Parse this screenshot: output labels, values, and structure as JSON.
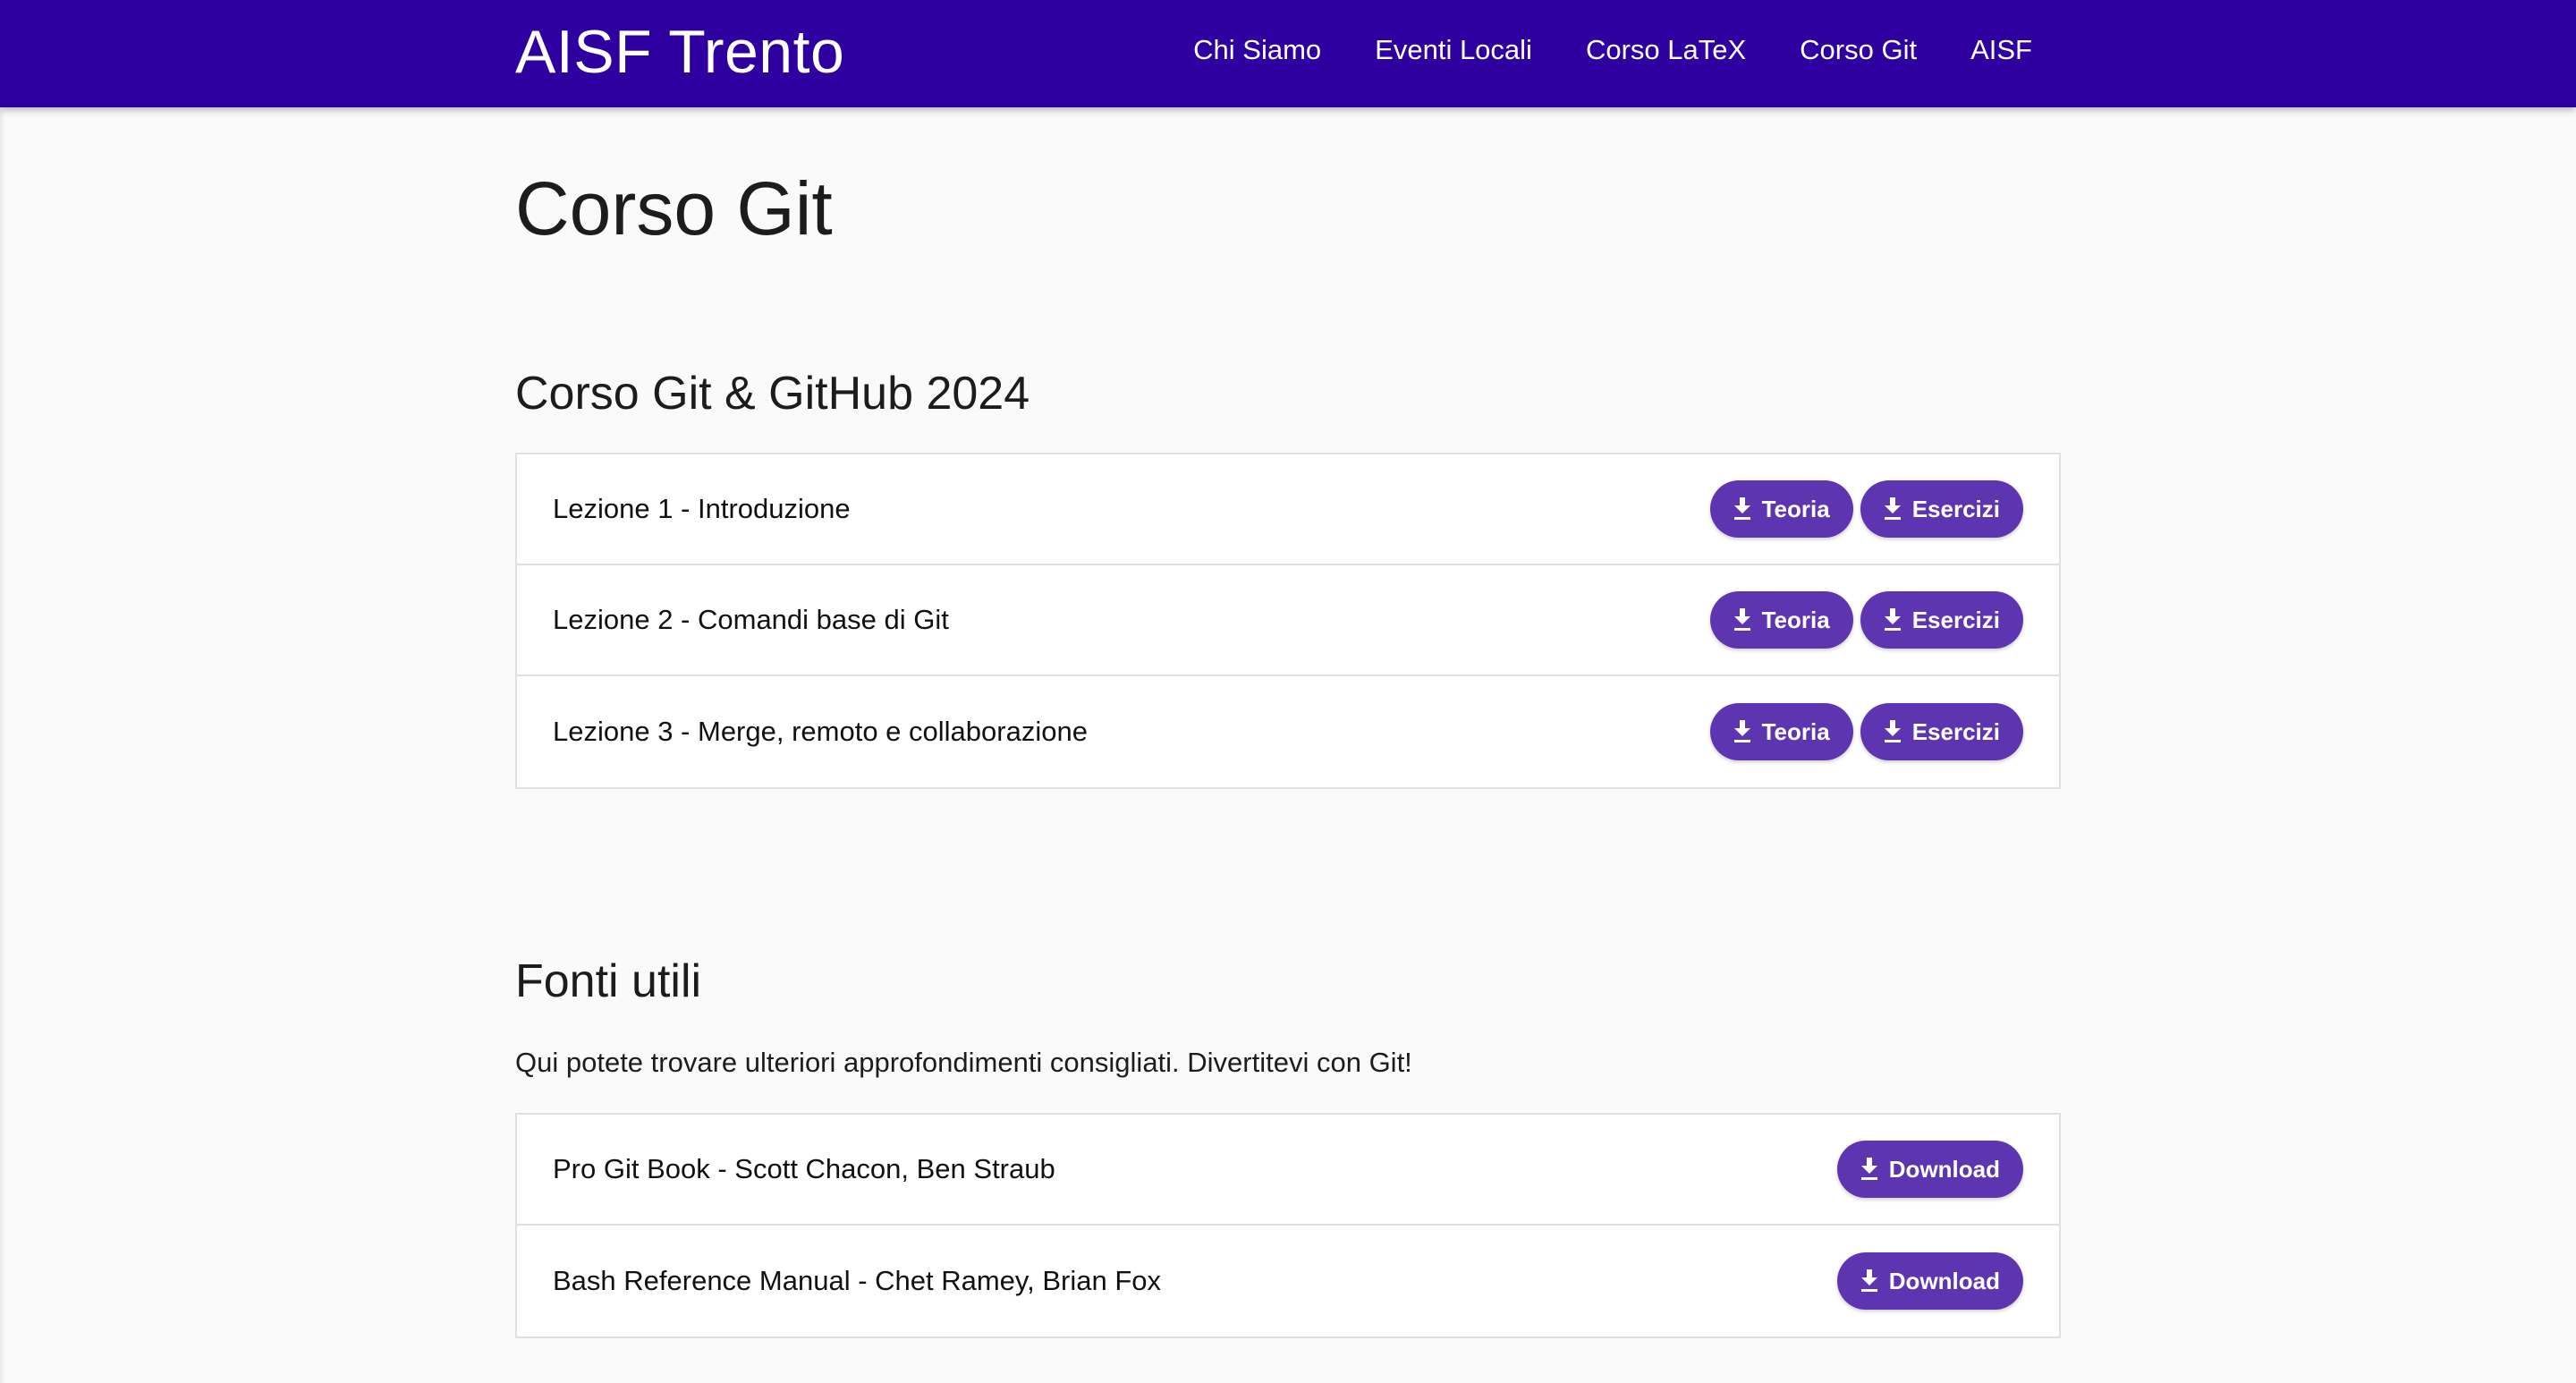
{
  "navbar": {
    "brand": "AISF Trento",
    "links": [
      "Chi Siamo",
      "Eventi Locali",
      "Corso LaTeX",
      "Corso Git",
      "AISF"
    ]
  },
  "page": {
    "title": "Corso Git"
  },
  "course": {
    "title": "Corso Git & GitHub 2024",
    "lessons": [
      {
        "label": "Lezione 1 - Introduzione",
        "theory": "Teoria",
        "exercises": "Esercizi"
      },
      {
        "label": "Lezione 2 - Comandi base di Git",
        "theory": "Teoria",
        "exercises": "Esercizi"
      },
      {
        "label": "Lezione 3 - Merge, remoto e collaborazione",
        "theory": "Teoria",
        "exercises": "Esercizi"
      }
    ]
  },
  "resources": {
    "title": "Fonti utili",
    "description": "Qui potete trovare ulteriori approfondimenti consigliati. Divertitevi con Git!",
    "items": [
      {
        "label": "Pro Git Book - Scott Chacon, Ben Straub",
        "button": "Download"
      },
      {
        "label": "Bash Reference Manual - Chet Ramey, Brian Fox",
        "button": "Download"
      }
    ]
  },
  "icons": {
    "button_icon": "download-icon"
  },
  "colors": {
    "navbar_bg": "#2e00a0",
    "button_bg": "#5e35b1",
    "page_bg": "#fafafa"
  }
}
